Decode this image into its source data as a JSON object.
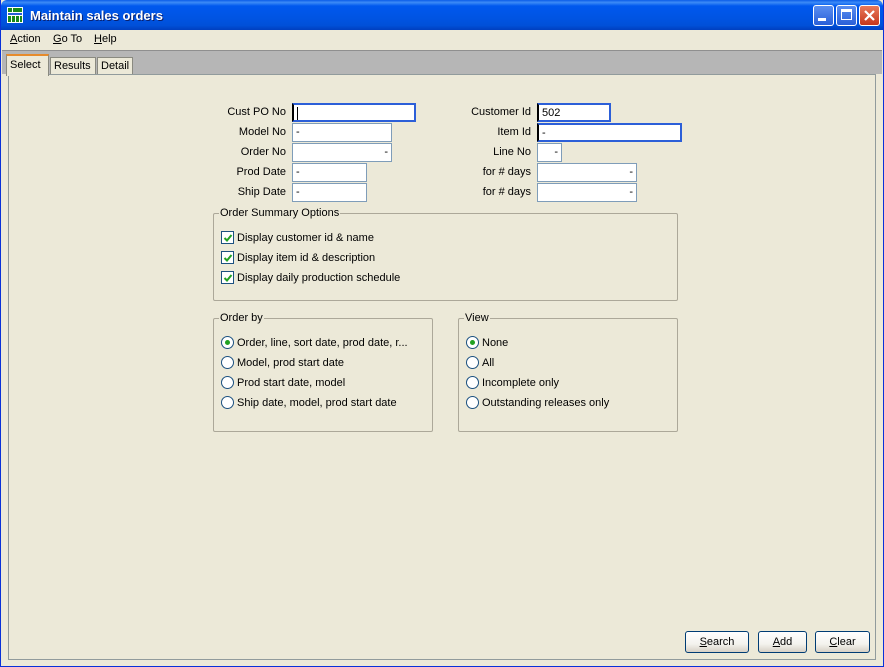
{
  "window": {
    "title": "Maintain sales orders"
  },
  "colors": {
    "titlebar": "#0054e3",
    "focus_border": "#2c5fd8",
    "active_tab_accent": "#e68b2c",
    "radio_dot": "#21a121"
  },
  "menu": [
    {
      "first": "A",
      "rest": "ction"
    },
    {
      "first": "G",
      "rest": "o To"
    },
    {
      "first": "H",
      "rest": "elp"
    }
  ],
  "tabs": [
    "Select",
    "Results",
    "Detail"
  ],
  "form": {
    "cust_po_no": {
      "label": "Cust PO No",
      "value": ""
    },
    "model_no": {
      "label": "Model No",
      "value": "-"
    },
    "order_no": {
      "label": "Order No",
      "value": "-"
    },
    "prod_date": {
      "label": "Prod Date",
      "value": "-"
    },
    "ship_date": {
      "label": "Ship Date",
      "value": "-"
    },
    "customer_id": {
      "label": "Customer Id",
      "value": "502"
    },
    "item_id": {
      "label": "Item Id",
      "value": "-"
    },
    "line_no": {
      "label": "Line No",
      "value": "-"
    },
    "prod_days": {
      "label": "for # days",
      "value": "-"
    },
    "ship_days": {
      "label": "for # days",
      "value": "-"
    }
  },
  "summary": {
    "title": "Order Summary Options",
    "options": [
      {
        "label": "Display customer id & name",
        "checked": true
      },
      {
        "label": "Display item id & description",
        "checked": true
      },
      {
        "label": "Display daily production schedule",
        "checked": true
      }
    ]
  },
  "order_by": {
    "title": "Order by",
    "options": [
      {
        "label": "Order, line, sort date, prod date, r...",
        "selected": true
      },
      {
        "label": "Model, prod start date",
        "selected": false
      },
      {
        "label": "Prod start date, model",
        "selected": false
      },
      {
        "label": "Ship date, model, prod start date",
        "selected": false
      }
    ]
  },
  "view": {
    "title": "View",
    "options": [
      {
        "label": "None",
        "selected": true
      },
      {
        "label": "All",
        "selected": false
      },
      {
        "label": "Incomplete only",
        "selected": false
      },
      {
        "label": "Outstanding releases only",
        "selected": false
      }
    ]
  },
  "buttons": {
    "search": {
      "first": "S",
      "rest": "earch"
    },
    "add": {
      "first": "A",
      "rest": "dd"
    },
    "clear": {
      "first": "C",
      "rest": "lear"
    }
  }
}
